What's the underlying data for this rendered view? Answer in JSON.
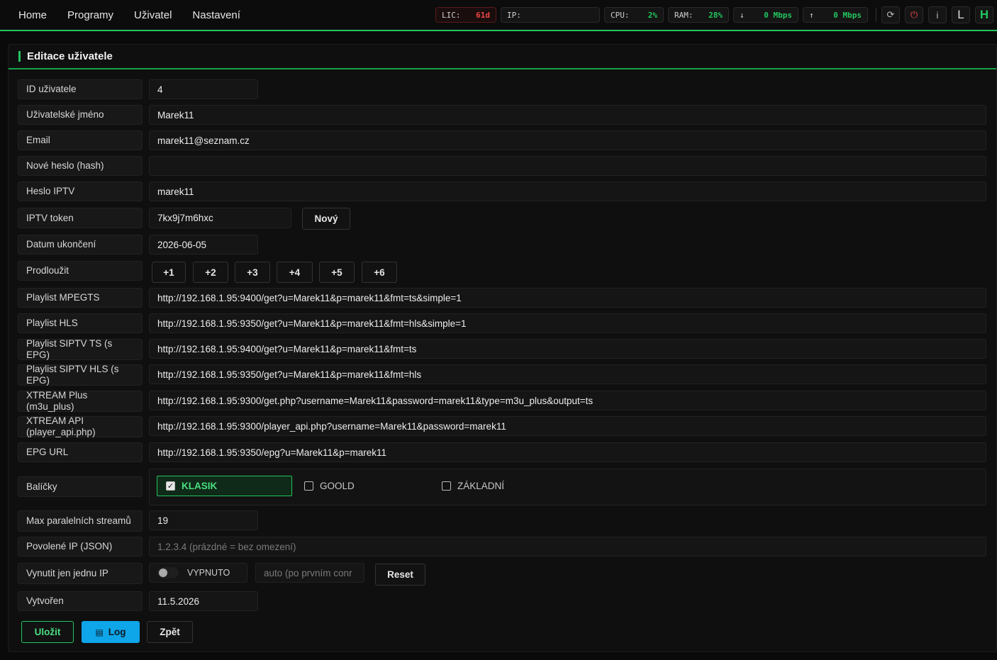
{
  "nav": {
    "items": [
      "Home",
      "Programy",
      "Uživatel",
      "Nastavení"
    ]
  },
  "stats": {
    "lic_label": "LIC:",
    "lic_value": "61d",
    "ip_label": "IP:",
    "ip_value": "",
    "cpu_label": "CPU:",
    "cpu_value": "2%",
    "ram_label": "RAM:",
    "ram_value": "28%",
    "down_icon": "↓",
    "down_value": "0 Mbps",
    "up_icon": "↑",
    "up_value": "0 Mbps",
    "right_icons": [
      "refresh-icon",
      "power-icon",
      "info-icon",
      "L",
      "H"
    ]
  },
  "panel": {
    "title": "Editace uživatele"
  },
  "fields": {
    "id_label": "ID uživatele",
    "id_value": "4",
    "username_label": "Uživatelské jméno",
    "username_value": "Marek11",
    "email_label": "Email",
    "email_value": "marek11@seznam.cz",
    "newpass_label": "Nové heslo (hash)",
    "newpass_value": "",
    "iptvpass_label": "Heslo IPTV",
    "iptvpass_value": "marek11",
    "token_label": "IPTV token",
    "token_value": "7kx9j7m6hxc",
    "token_new_btn": "Nový",
    "enddate_label": "Datum ukončení",
    "enddate_value": "2026-06-05",
    "extend_label": "Prodloužit",
    "extend_buttons": [
      "+1",
      "+2",
      "+3",
      "+4",
      "+5",
      "+6"
    ],
    "mpegts_label": "Playlist MPEGTS",
    "mpegts_value": "http://192.168.1.95:9400/get?u=Marek11&p=marek11&fmt=ts&simple=1",
    "hls_label": "Playlist HLS",
    "hls_value": "http://192.168.1.95:9350/get?u=Marek11&p=marek11&fmt=hls&simple=1",
    "siptv_ts_label": "Playlist SIPTV TS (s EPG)",
    "siptv_ts_value": "http://192.168.1.95:9400/get?u=Marek11&p=marek11&fmt=ts",
    "siptv_hls_label": "Playlist SIPTV HLS (s EPG)",
    "siptv_hls_value": "http://192.168.1.95:9350/get?u=Marek11&p=marek11&fmt=hls",
    "xtream_plus_label": "XTREAM Plus (m3u_plus)",
    "xtream_plus_value": "http://192.168.1.95:9300/get.php?username=Marek11&password=marek11&type=m3u_plus&output=ts",
    "xtream_api_label": "XTREAM API (player_api.php)",
    "xtream_api_value": "http://192.168.1.95:9300/player_api.php?username=Marek11&password=marek11",
    "epg_label": "EPG URL",
    "epg_value": "http://192.168.1.95:9350/epg?u=Marek11&p=marek11",
    "packages_label": "Balíčky",
    "packages": [
      {
        "name": "KLASIK",
        "checked": true
      },
      {
        "name": "GOOLD",
        "checked": false
      },
      {
        "name": "ZÁKLADNÍ",
        "checked": false
      }
    ],
    "max_streams_label": "Max paralelních streamů",
    "max_streams_value": "19",
    "allowed_ip_label": "Povolené IP (JSON)",
    "allowed_ip_placeholder": "1.2.3.4  (prázdné = bez omezení)",
    "single_ip_label": "Vynutit jen jednu IP",
    "single_ip_toggle": "VYPNUTO",
    "single_ip_placeholder": "auto (po prvním conr",
    "single_ip_reset": "Reset",
    "created_label": "Vytvořen",
    "created_value": "11.5.2026"
  },
  "actions": {
    "save": "Uložit",
    "log": "Log",
    "back": "Zpět"
  },
  "colors": {
    "accent": "#22c55e",
    "danger": "#ef4444",
    "log_button": "#0ea5e9"
  }
}
